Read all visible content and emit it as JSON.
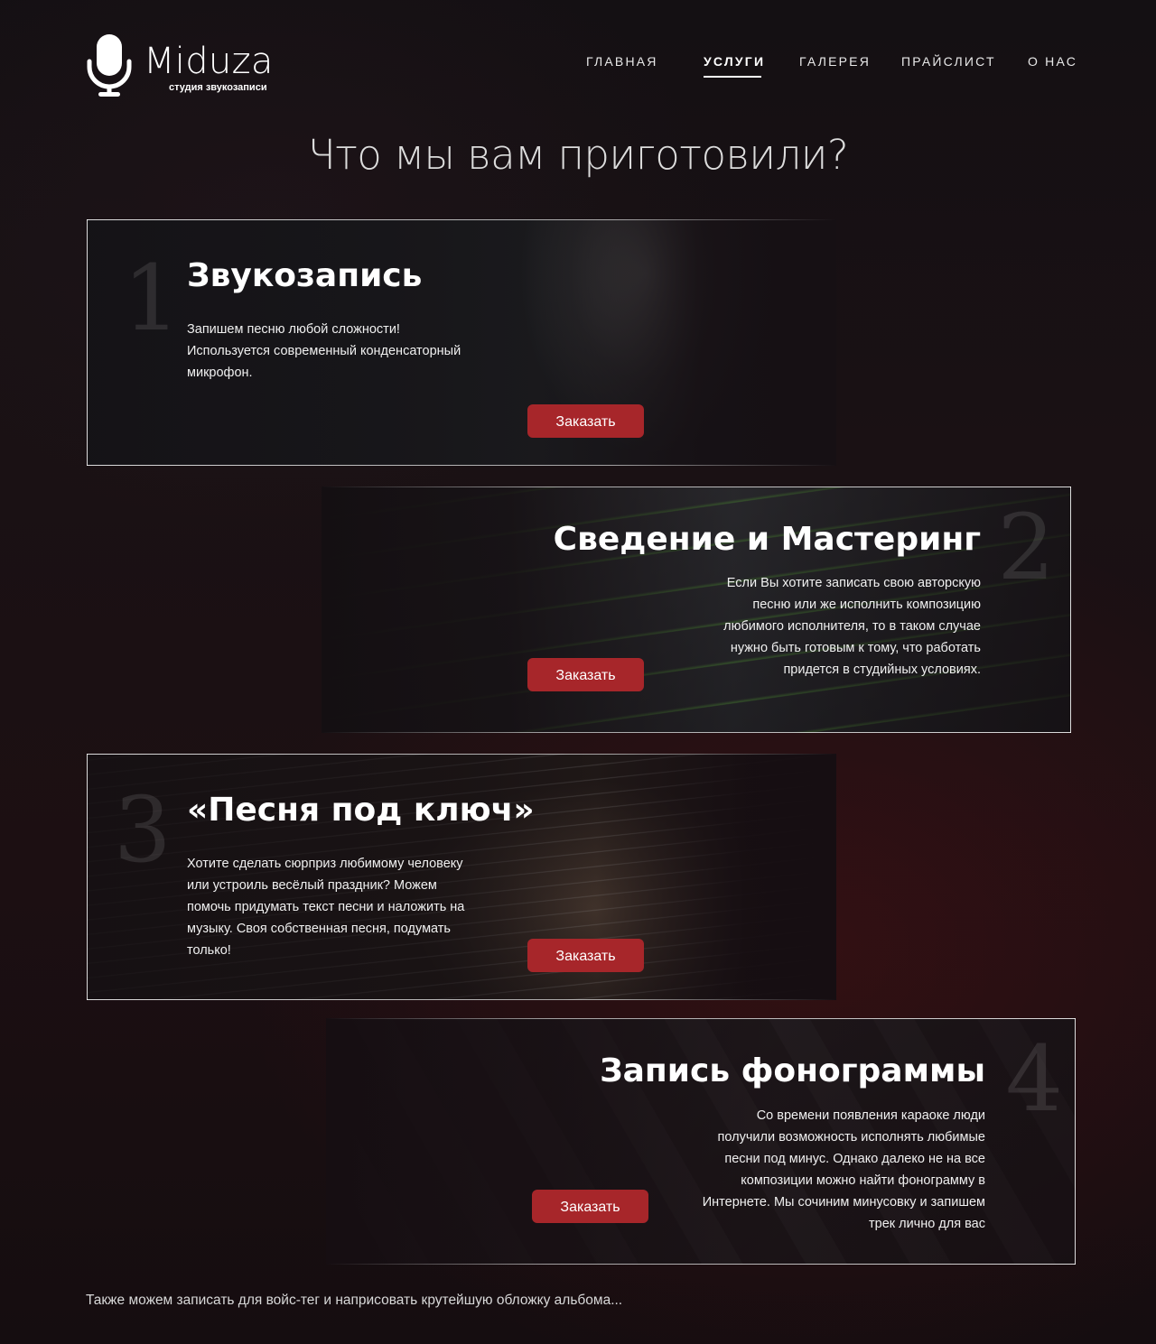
{
  "brand": {
    "name": "Miduza",
    "subtitle": "студия звукозаписи"
  },
  "nav": {
    "items": [
      {
        "label": "ГЛАВНАЯ",
        "active": false
      },
      {
        "label": "УСЛУГИ",
        "active": true
      },
      {
        "label": "ГАЛЕРЕЯ",
        "active": false
      },
      {
        "label": "ПРАЙСЛИСТ",
        "active": false
      },
      {
        "label": "О НАС",
        "active": false
      }
    ]
  },
  "page_title": "Что мы вам приготовили?",
  "services": [
    {
      "number": "1",
      "title": "Звукозапись",
      "text": "Запишем песню любой сложности! Используется современный конденсаторный микрофон.",
      "button": "Заказать"
    },
    {
      "number": "2",
      "title": "Сведение и Мастеринг",
      "text": "Если Вы хотите записать свою авторскую песню или же исполнить композицию любимого исполнителя, то в таком случае нужно быть готовым к тому, что работать придется в студийных условиях.",
      "button": "Заказать"
    },
    {
      "number": "3",
      "title": "«Песня под ключ»",
      "text": "Хотите сделать сюрприз любимому человеку или устроиль весёлый праздник? Можем помочь придумать текст песни и наложить на музыку. Своя собственная песня, подумать только!",
      "button": "Заказать"
    },
    {
      "number": "4",
      "title": "Запись фонограммы",
      "text": "Со времени появления караоке люди получили возможность исполнять любимые песни под минус. Однако далеко не на все композиции можно найти фонограмму в Интернете. Мы сочиним минусовку и запишем  трек лично для вас",
      "button": "Заказать"
    }
  ],
  "footer_note": "Также можем записать для войс-тег и наприсовать крутейшую  обложку альбома...",
  "colors": {
    "accent": "#a7262a",
    "background": "#1a1114"
  },
  "icons": {
    "logo": "microphone-icon"
  }
}
